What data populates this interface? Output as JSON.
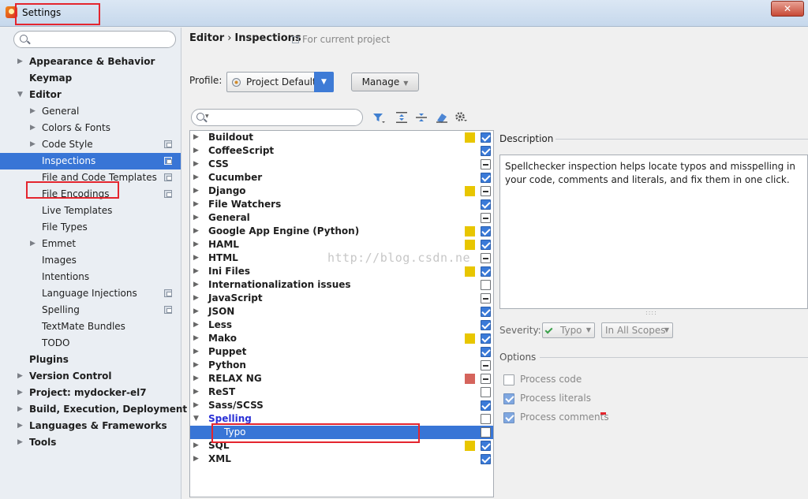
{
  "window": {
    "title": "Settings",
    "close_label": "✕"
  },
  "sidebar": {
    "search_placeholder": "",
    "items": [
      {
        "label": "Appearance & Behavior",
        "level": 0,
        "arrow": "right",
        "bold": true,
        "project_icon": false,
        "selected": false
      },
      {
        "label": "Keymap",
        "level": 0,
        "arrow": "none",
        "bold": true,
        "project_icon": false,
        "selected": false
      },
      {
        "label": "Editor",
        "level": 0,
        "arrow": "down",
        "bold": true,
        "project_icon": false,
        "selected": false
      },
      {
        "label": "General",
        "level": 1,
        "arrow": "right",
        "bold": false,
        "project_icon": false,
        "selected": false
      },
      {
        "label": "Colors & Fonts",
        "level": 1,
        "arrow": "right",
        "bold": false,
        "project_icon": false,
        "selected": false
      },
      {
        "label": "Code Style",
        "level": 1,
        "arrow": "right",
        "bold": false,
        "project_icon": true,
        "selected": false
      },
      {
        "label": "Inspections",
        "level": 1,
        "arrow": "none",
        "bold": false,
        "project_icon": true,
        "selected": true
      },
      {
        "label": "File and Code Templates",
        "level": 1,
        "arrow": "none",
        "bold": false,
        "project_icon": true,
        "selected": false
      },
      {
        "label": "File Encodings",
        "level": 1,
        "arrow": "none",
        "bold": false,
        "project_icon": true,
        "selected": false
      },
      {
        "label": "Live Templates",
        "level": 1,
        "arrow": "none",
        "bold": false,
        "project_icon": false,
        "selected": false
      },
      {
        "label": "File Types",
        "level": 1,
        "arrow": "none",
        "bold": false,
        "project_icon": false,
        "selected": false
      },
      {
        "label": "Emmet",
        "level": 1,
        "arrow": "right",
        "bold": false,
        "project_icon": false,
        "selected": false
      },
      {
        "label": "Images",
        "level": 1,
        "arrow": "none",
        "bold": false,
        "project_icon": false,
        "selected": false
      },
      {
        "label": "Intentions",
        "level": 1,
        "arrow": "none",
        "bold": false,
        "project_icon": false,
        "selected": false
      },
      {
        "label": "Language Injections",
        "level": 1,
        "arrow": "none",
        "bold": false,
        "project_icon": true,
        "selected": false
      },
      {
        "label": "Spelling",
        "level": 1,
        "arrow": "none",
        "bold": false,
        "project_icon": true,
        "selected": false
      },
      {
        "label": "TextMate Bundles",
        "level": 1,
        "arrow": "none",
        "bold": false,
        "project_icon": false,
        "selected": false
      },
      {
        "label": "TODO",
        "level": 1,
        "arrow": "none",
        "bold": false,
        "project_icon": false,
        "selected": false
      },
      {
        "label": "Plugins",
        "level": 0,
        "arrow": "none",
        "bold": true,
        "project_icon": false,
        "selected": false
      },
      {
        "label": "Version Control",
        "level": 0,
        "arrow": "right",
        "bold": true,
        "project_icon": false,
        "selected": false
      },
      {
        "label": "Project: mydocker-el7",
        "level": 0,
        "arrow": "right",
        "bold": true,
        "project_icon": false,
        "selected": false
      },
      {
        "label": "Build, Execution, Deployment",
        "level": 0,
        "arrow": "right",
        "bold": true,
        "project_icon": false,
        "selected": false
      },
      {
        "label": "Languages & Frameworks",
        "level": 0,
        "arrow": "right",
        "bold": true,
        "project_icon": false,
        "selected": false
      },
      {
        "label": "Tools",
        "level": 0,
        "arrow": "right",
        "bold": true,
        "project_icon": false,
        "selected": false
      }
    ]
  },
  "breadcrumb": {
    "parent": "Editor",
    "separator": "›",
    "current": "Inspections",
    "scope_note": "For current project"
  },
  "profile": {
    "label": "Profile:",
    "value": "Project Default",
    "manage_label": "Manage"
  },
  "inspections": {
    "search_placeholder": "",
    "rows": [
      {
        "name": "Buildout",
        "arrow": "right",
        "child": false,
        "severity": "#e8c600",
        "state": "checked"
      },
      {
        "name": "CoffeeScript",
        "arrow": "right",
        "child": false,
        "severity": "",
        "state": "checked"
      },
      {
        "name": "CSS",
        "arrow": "right",
        "child": false,
        "severity": "",
        "state": "partial"
      },
      {
        "name": "Cucumber",
        "arrow": "right",
        "child": false,
        "severity": "",
        "state": "checked"
      },
      {
        "name": "Django",
        "arrow": "right",
        "child": false,
        "severity": "#e8c600",
        "state": "partial"
      },
      {
        "name": "File Watchers",
        "arrow": "right",
        "child": false,
        "severity": "",
        "state": "checked"
      },
      {
        "name": "General",
        "arrow": "right",
        "child": false,
        "severity": "",
        "state": "partial"
      },
      {
        "name": "Google App Engine (Python)",
        "arrow": "right",
        "child": false,
        "severity": "#e8c600",
        "state": "checked"
      },
      {
        "name": "HAML",
        "arrow": "right",
        "child": false,
        "severity": "#e8c600",
        "state": "checked"
      },
      {
        "name": "HTML",
        "arrow": "right",
        "child": false,
        "severity": "",
        "state": "partial"
      },
      {
        "name": "Ini Files",
        "arrow": "right",
        "child": false,
        "severity": "#e8c600",
        "state": "checked"
      },
      {
        "name": "Internationalization issues",
        "arrow": "right",
        "child": false,
        "severity": "",
        "state": "unchecked"
      },
      {
        "name": "JavaScript",
        "arrow": "right",
        "child": false,
        "severity": "",
        "state": "partial"
      },
      {
        "name": "JSON",
        "arrow": "right",
        "child": false,
        "severity": "",
        "state": "checked"
      },
      {
        "name": "Less",
        "arrow": "right",
        "child": false,
        "severity": "",
        "state": "checked"
      },
      {
        "name": "Mako",
        "arrow": "right",
        "child": false,
        "severity": "#e8c600",
        "state": "checked"
      },
      {
        "name": "Puppet",
        "arrow": "right",
        "child": false,
        "severity": "",
        "state": "checked"
      },
      {
        "name": "Python",
        "arrow": "right",
        "child": false,
        "severity": "",
        "state": "partial"
      },
      {
        "name": "RELAX NG",
        "arrow": "right",
        "child": false,
        "severity": "#d5645c",
        "state": "partial"
      },
      {
        "name": "ReST",
        "arrow": "right",
        "child": false,
        "severity": "",
        "state": "unchecked"
      },
      {
        "name": "Sass/SCSS",
        "arrow": "right",
        "child": false,
        "severity": "",
        "state": "checked"
      },
      {
        "name": "Spelling",
        "arrow": "down",
        "child": false,
        "severity": "",
        "state": "unchecked",
        "expanded": true
      },
      {
        "name": "Typo",
        "arrow": "none",
        "child": true,
        "severity": "",
        "state": "unchecked",
        "selected": true
      },
      {
        "name": "SQL",
        "arrow": "right",
        "child": false,
        "severity": "#e8c600",
        "state": "checked"
      },
      {
        "name": "XML",
        "arrow": "right",
        "child": false,
        "severity": "",
        "state": "checked"
      }
    ]
  },
  "watermark": "http://blog.csdn.ne",
  "description": {
    "title": "Description",
    "text": "Spellchecker inspection helps locate typos and misspelling in your code, comments and literals, and fix them in one click."
  },
  "severity": {
    "label": "Severity:",
    "value": "Typo",
    "scope": "In All Scopes"
  },
  "options": {
    "title": "Options",
    "items": [
      {
        "label": "Process code",
        "checked": false
      },
      {
        "label": "Process literals",
        "checked": true
      },
      {
        "label": "Process comments",
        "checked": true
      }
    ]
  },
  "colors": {
    "accent": "#3875d6",
    "highlight_box": "#e4252e",
    "warning": "#e8c600",
    "error": "#d5645c"
  }
}
